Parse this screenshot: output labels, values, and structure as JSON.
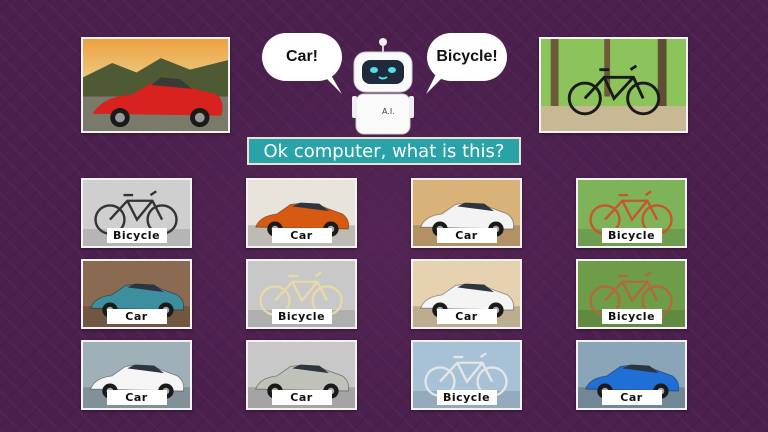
{
  "bubbles": {
    "left": "Car!",
    "right": "Bicycle!"
  },
  "robot": {
    "badge": "A.I."
  },
  "question": "Ok computer, what is this?",
  "hero": {
    "left": "red convertible car",
    "right": "bicycle in forest"
  },
  "grid": [
    {
      "label": "Bicycle",
      "kind": "bicycle",
      "scene": "#cfcfcf",
      "color": "#333333"
    },
    {
      "label": "Car",
      "kind": "car",
      "scene": "#e8e4dc",
      "color": "#d65a12"
    },
    {
      "label": "Car",
      "kind": "car",
      "scene": "#d9b27a",
      "color": "#f3f3f3"
    },
    {
      "label": "Bicycle",
      "kind": "bicycle",
      "scene": "#7fb35a",
      "color": "#c4582a"
    },
    {
      "label": "Car",
      "kind": "car",
      "scene": "#8a6a50",
      "color": "#3d8fa0"
    },
    {
      "label": "Bicycle",
      "kind": "bicycle",
      "scene": "#c8c8c8",
      "color": "#e7d9a8"
    },
    {
      "label": "Car",
      "kind": "car",
      "scene": "#e6d2b0",
      "color": "#f4f4f4"
    },
    {
      "label": "Bicycle",
      "kind": "bicycle",
      "scene": "#6f9c49",
      "color": "#b26a3a"
    },
    {
      "label": "Car",
      "kind": "car",
      "scene": "#9fb0b9",
      "color": "#f5f5f5"
    },
    {
      "label": "Car",
      "kind": "car",
      "scene": "#c8c8c8",
      "color": "#bfc2b8"
    },
    {
      "label": "Bicycle",
      "kind": "bicycle",
      "scene": "#a7c2d7",
      "color": "#e5e5e5"
    },
    {
      "label": "Car",
      "kind": "car",
      "scene": "#8aa4b8",
      "color": "#1f6fd6"
    }
  ]
}
